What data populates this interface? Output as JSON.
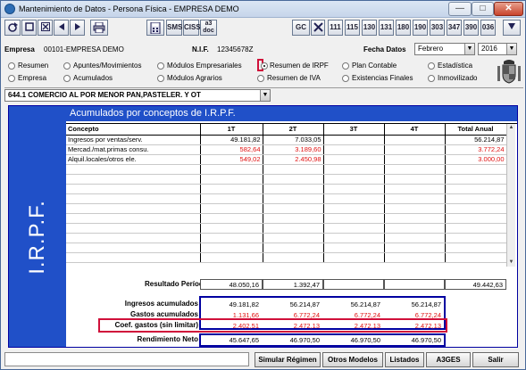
{
  "window": {
    "title": "Mantenimiento de Datos - Persona Física - EMPRESA DEMO"
  },
  "toolbar": {
    "nav_icons": [
      "refresh-icon",
      "stop-icon",
      "close-record-icon",
      "first-record-icon",
      "next-record-icon",
      "print-icon",
      "calculator-icon"
    ],
    "text_buttons": [
      "SMS",
      "CISS",
      "a3 doc",
      "GC",
      "111",
      "115",
      "130",
      "131",
      "180",
      "190",
      "303",
      "347",
      "390",
      "036"
    ]
  },
  "info": {
    "empresa_label": "Empresa",
    "empresa_value": "00101-EMPRESA DEMO",
    "nif_label": "N.I.F.",
    "nif_value": "12345678Z",
    "fecha_label": "Fecha Datos",
    "month": "Febrero",
    "year": "2016"
  },
  "radios": [
    {
      "label": "Resumen",
      "selected": false
    },
    {
      "label": "Apuntes/Movimientos",
      "selected": false
    },
    {
      "label": "Módulos Empresariales",
      "selected": false
    },
    {
      "label": "Resumen de IRPF",
      "selected": true
    },
    {
      "label": "Plan Contable",
      "selected": false
    },
    {
      "label": "Estadística",
      "selected": false
    },
    {
      "label": "Empresa",
      "selected": false
    },
    {
      "label": "Acumulados",
      "selected": false
    },
    {
      "label": "Módulos Agrarios",
      "selected": false
    },
    {
      "label": "Resumen de IVA",
      "selected": false
    },
    {
      "label": "Existencias Finales",
      "selected": false
    },
    {
      "label": "Inmovilizado",
      "selected": false
    }
  ],
  "activity": {
    "value": "644.1  COMERCIO AL POR MENOR PAN,PASTELER. Y OT"
  },
  "panel": {
    "side_label": "I.R.P.F.",
    "header": "Acumulados por conceptos de I.R.P.F."
  },
  "table": {
    "columns": [
      "Concepto",
      "1T",
      "2T",
      "3T",
      "4T",
      "Total Anual"
    ],
    "rows": [
      {
        "concept": "Ingresos por ventas/serv.",
        "values": [
          "49.181,82",
          "7.033,05",
          "",
          "",
          "56.214,87"
        ],
        "red": false
      },
      {
        "concept": "Mercad./mat.primas consu.",
        "values": [
          "582,64",
          "3.189,60",
          "",
          "",
          "3.772,24"
        ],
        "red": true
      },
      {
        "concept": "Alquil.locales/otros ele.",
        "values": [
          "549,02",
          "2.450,98",
          "",
          "",
          "3.000,00"
        ],
        "red": true
      }
    ]
  },
  "resultado": {
    "label": "Resultado Período",
    "values": [
      "48.050,16",
      "1.392,47",
      "",
      "",
      "49.442,63"
    ]
  },
  "summary": [
    {
      "label": "Ingresos acumulados",
      "values": [
        "49.181,82",
        "56.214,87",
        "56.214,87",
        "56.214,87"
      ],
      "red": false
    },
    {
      "label": "Gastos acumulados",
      "values": [
        "1.131,66",
        "6.772,24",
        "6.772,24",
        "6.772,24"
      ],
      "red": true
    },
    {
      "label": "Coef. gastos (sin limitar)",
      "values": [
        "2.402,51",
        "2.472,13",
        "2.472,13",
        "2.472,13"
      ],
      "red": true
    }
  ],
  "rendimiento": {
    "label": "Rendimiento Neto",
    "values": [
      "45.647,65",
      "46.970,50",
      "46.970,50",
      "46.970,50"
    ]
  },
  "buttons": {
    "simular": "Simular Régimen",
    "otros": "Otros Modelos",
    "listados": "Listados",
    "a3ges": "A3GES",
    "salir": "Salir"
  }
}
